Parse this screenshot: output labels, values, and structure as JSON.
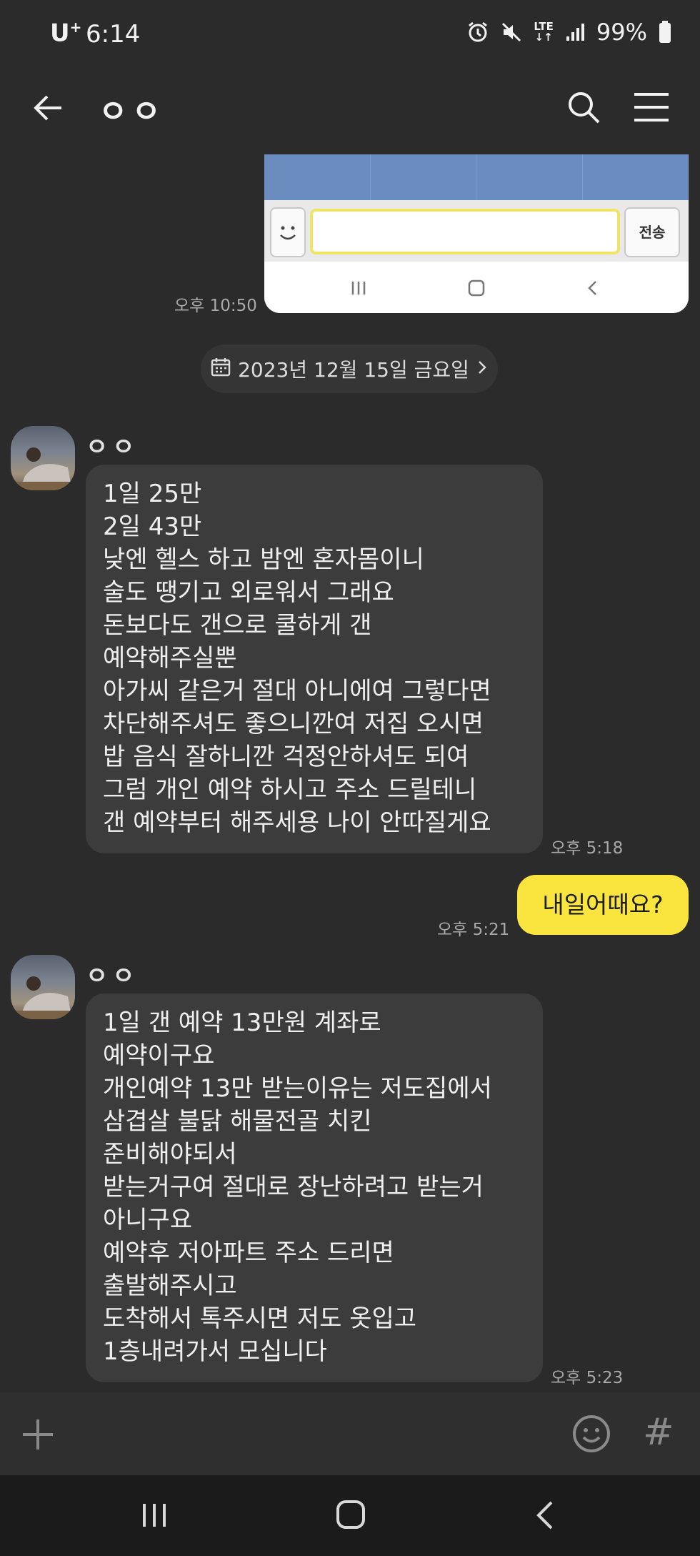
{
  "status_bar": {
    "carrier": "U",
    "carrier_plus": "+",
    "time": "6:14",
    "network": "LTE",
    "battery": "99%"
  },
  "app_bar": {
    "title": "ㅇㅇ",
    "icons": [
      "back-arrow-icon",
      "search-icon",
      "hamburger-menu-icon"
    ]
  },
  "embedded_image": {
    "send_label": "전송",
    "timestamp": "오후 10:50"
  },
  "date_divider": {
    "label": "2023년 12월 15일 금요일",
    "icon": "calendar-icon"
  },
  "messages": [
    {
      "sender": "ㅇㅇ",
      "direction": "incoming",
      "lines": [
        "1일 25만",
        "2일 43만",
        "낮엔 헬스 하고 밤엔 혼자몸이니",
        "술도 땡기고 외로워서 그래요",
        "돈보다도 갠으로 쿨하게 갠",
        "예약해주실뿐",
        "아가씨 같은거 절대 아니에여 그렇다면",
        "차단해주셔도 좋으니깐여 저집 오시면",
        "밥 음식 잘하니깐 걱정안하셔도 되여",
        "그럼 개인 예약 하시고 주소 드릴테니",
        "갠 예약부터 해주세용 나이 안따질게요"
      ],
      "time": "오후 5:18"
    },
    {
      "direction": "outgoing",
      "text": "내일어때요?",
      "time": "오후 5:21"
    },
    {
      "sender": "ㅇㅇ",
      "direction": "incoming",
      "lines": [
        "1일 갠 예약 13만원 계좌로",
        "예약이구요",
        "개인예약 13만 받는이유는 저도집에서",
        "삼겹살 불닭 해물전골 치킨",
        "준비해야되서",
        "받는거구여 절대로 장난하려고 받는거",
        "아니구요",
        "예약후 저아파트 주소 드리면",
        "출발해주시고",
        "도착해서 톡주시면 저도 옷입고",
        "1층내려가서 모십니다"
      ],
      "time": "오후 5:23"
    }
  ],
  "composer": {
    "hash_label": "#",
    "icons": [
      "plus-icon",
      "emoji-icon",
      "hash-icon"
    ]
  },
  "colors": {
    "background": "#2b2b2b",
    "incoming_bubble": "#3c3c3c",
    "outgoing_bubble": "#fae53e",
    "timestamp": "#a9a9a9",
    "nav_bar": "#1b1b1b"
  }
}
